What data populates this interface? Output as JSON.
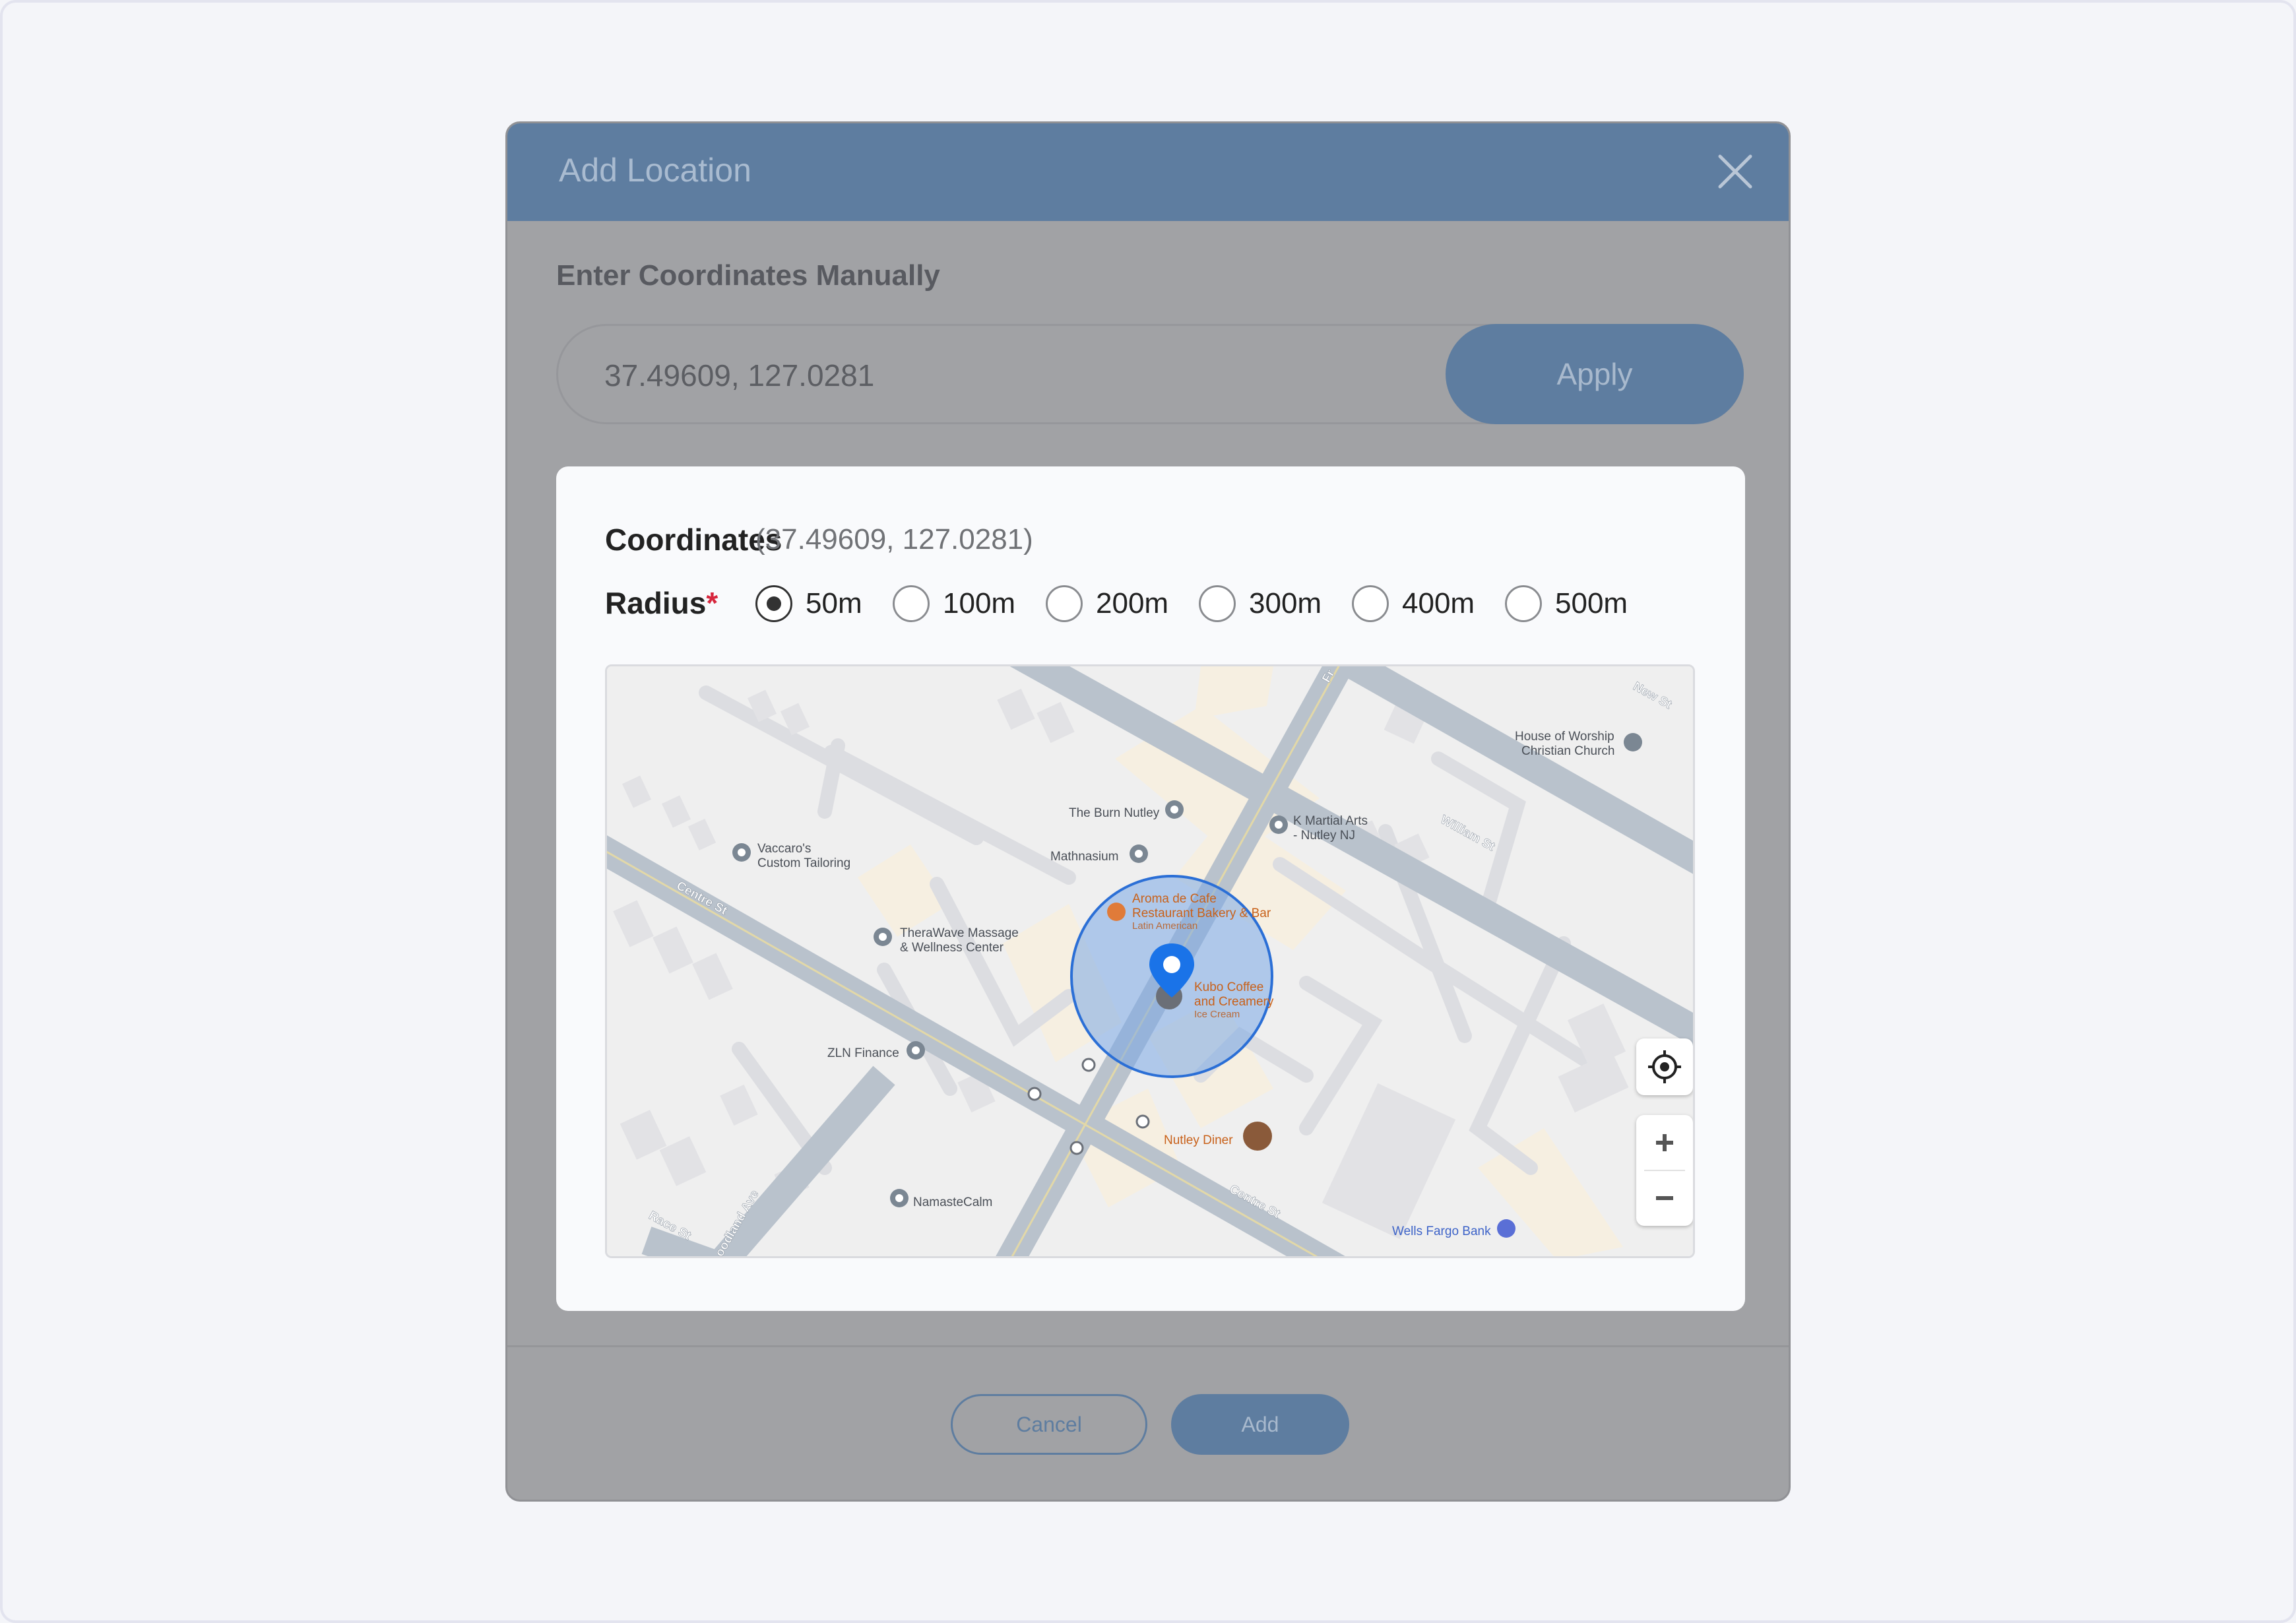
{
  "dialog": {
    "title": "Add Location",
    "close_icon": "close-icon"
  },
  "manual": {
    "section_label": "Enter Coordinates Manually",
    "input_value": "37.49609, 127.0281",
    "apply_label": "Apply"
  },
  "card": {
    "coordinates_label": "Coordinates",
    "coordinates_value": "(37.49609, 127.0281)",
    "radius_label": "Radius",
    "radius_required_mark": "*",
    "radius_options": [
      "50m",
      "100m",
      "200m",
      "300m",
      "400m",
      "500m"
    ],
    "radius_selected": "50m"
  },
  "map": {
    "streets": [
      "Centre St",
      "William St",
      "New St",
      "Race St",
      "oodland Ave",
      "Fr",
      "Centre St"
    ],
    "places": [
      {
        "name": "The Burn Nutley",
        "icon": "pin-icon"
      },
      {
        "name": "Mathnasium",
        "icon": "pin-icon"
      },
      {
        "name": "K Martial Arts",
        "name2": "- Nutley NJ",
        "icon": "pin-icon"
      },
      {
        "name": "House of Worship",
        "name2": "Christian Church",
        "icon": "church-icon"
      },
      {
        "name": "Vaccaro's",
        "name2": "Custom Tailoring",
        "icon": "pin-icon"
      },
      {
        "name": "TheraWave Massage",
        "name2": "& Wellness Center",
        "icon": "pin-icon"
      },
      {
        "name": "Aroma de Cafe",
        "name2": "Restaurant Bakery & Bar",
        "sub": "Latin American",
        "icon": "restaurant-icon"
      },
      {
        "name": "Kubo Coffee",
        "name2": "and Creamery",
        "sub": "Ice Cream",
        "icon": "photo-icon"
      },
      {
        "name": "ZLN Finance",
        "icon": "pin-icon"
      },
      {
        "name": "Nutley Diner",
        "icon": "photo-icon"
      },
      {
        "name": "NamasteCalm",
        "icon": "pin-icon"
      },
      {
        "name": "Wells Fargo Bank",
        "icon": "bank-icon"
      }
    ],
    "controls": {
      "locate_icon": "crosshair-icon",
      "zoom_in_icon": "plus-icon",
      "zoom_out_icon": "minus-icon"
    },
    "colors": {
      "radius_fill": "#7aa7e6",
      "radius_stroke": "#2b6fd6",
      "marker": "#1a73e8"
    }
  },
  "footer": {
    "cancel_label": "Cancel",
    "add_label": "Add"
  },
  "colors": {
    "header": "#5e7da0",
    "overlay": "#a1a2a5",
    "required": "#d7263d"
  }
}
